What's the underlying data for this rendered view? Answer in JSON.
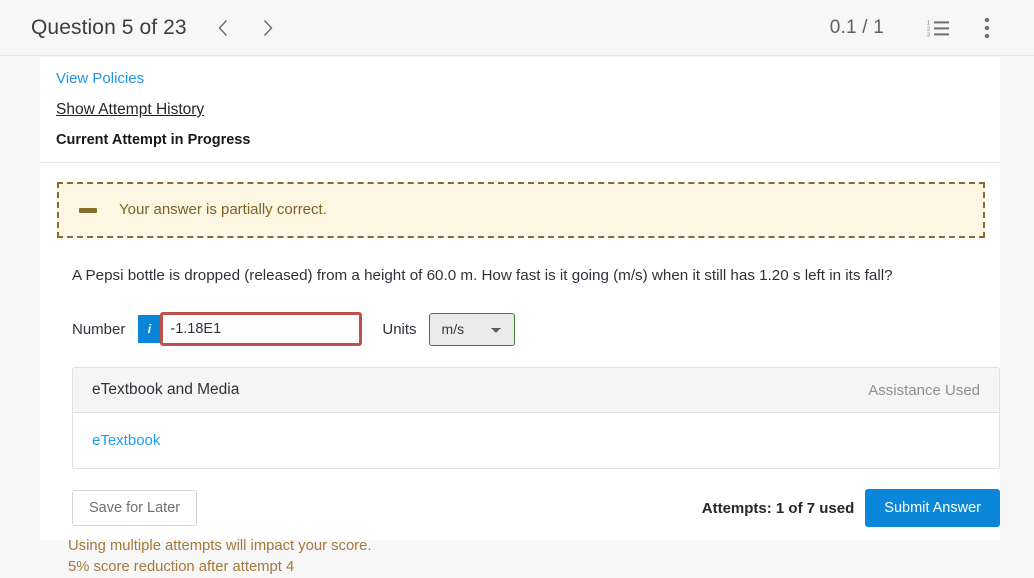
{
  "topbar": {
    "question_title": "Question 5 of 23",
    "prev_icon": "chevron-left-icon",
    "next_icon": "chevron-right-icon",
    "score": "0.1 / 1",
    "list_icon": "numbered-list-icon",
    "menu_icon": "kebab-menu-icon"
  },
  "links": {
    "view_policies": "View Policies",
    "show_attempt_history": "Show Attempt History",
    "current_attempt": "Current Attempt in Progress"
  },
  "alert": {
    "icon": "minus-icon",
    "text": "Your answer is partially correct.",
    "border_color": "#8a6c2f",
    "background_color": "#fcf6e3",
    "text_color": "#7d6227"
  },
  "question": {
    "text": "A Pepsi bottle is dropped (released) from a height of 60.0 m. How fast is it going (m/s) when it still has 1.20 s left in its fall?"
  },
  "answer": {
    "number_label": "Number",
    "info_badge": "i",
    "info_badge_color": "#0a85d8",
    "number_value": "-1.18E1",
    "number_placeholder": "",
    "number_border_color": "#c0504a",
    "units_label": "Units",
    "units_value": "m/s",
    "units_options": [
      "m/s"
    ],
    "units_border_color": "#3f7b35"
  },
  "panel": {
    "title": "eTextbook and Media",
    "assistance": "Assistance Used",
    "link": "eTextbook"
  },
  "actions": {
    "save_label": "Save for Later",
    "attempts_text": "Attempts: 1 of 7 used",
    "submit_label": "Submit Answer",
    "submit_color": "#0b87da"
  },
  "warnings": {
    "line1": "Using multiple attempts will impact your score.",
    "line2": "5% score reduction after attempt 4",
    "color": "#a37a3c"
  }
}
